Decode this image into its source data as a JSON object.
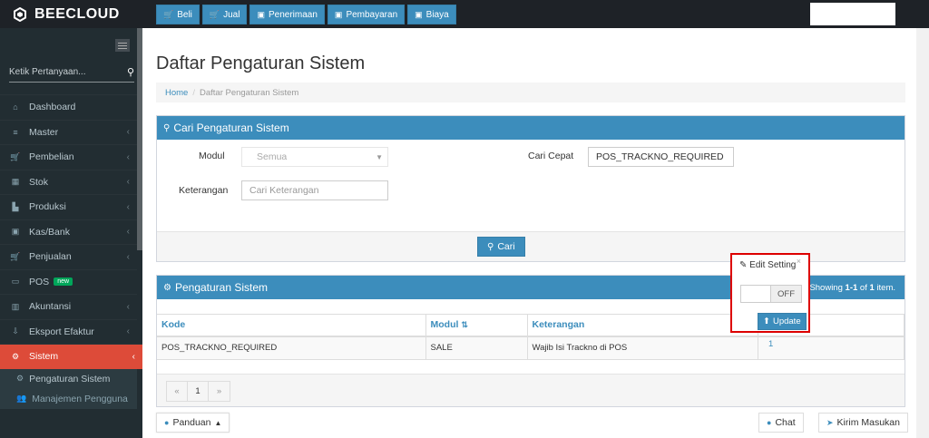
{
  "brand": {
    "name": "BEECLOUD"
  },
  "topnav": [
    {
      "icon": "cart-icon",
      "glyph": "🛒",
      "label": "Beli"
    },
    {
      "icon": "cart-icon",
      "glyph": "🛒",
      "label": "Jual"
    },
    {
      "icon": "money-icon",
      "glyph": "▣",
      "label": "Penerimaan"
    },
    {
      "icon": "money-icon",
      "glyph": "▣",
      "label": "Pembayaran"
    },
    {
      "icon": "money-icon",
      "glyph": "▣",
      "label": "Biaya"
    }
  ],
  "sidebar": {
    "search_placeholder": "Ketik Pertanyaan...",
    "items": [
      {
        "label": "Dashboard",
        "icon": "dashboard-icon"
      },
      {
        "label": "Master",
        "icon": "list-icon"
      },
      {
        "label": "Pembelian",
        "icon": "cart-icon"
      },
      {
        "label": "Stok",
        "icon": "stock-icon"
      },
      {
        "label": "Produksi",
        "icon": "factory-icon"
      },
      {
        "label": "Kas/Bank",
        "icon": "money-icon"
      },
      {
        "label": "Penjualan",
        "icon": "cart-icon"
      },
      {
        "label": "POS",
        "icon": "monitor-icon",
        "badge": "new"
      },
      {
        "label": "Akuntansi",
        "icon": "chart-icon"
      },
      {
        "label": "Eksport Efaktur",
        "icon": "export-icon"
      },
      {
        "label": "Sistem",
        "icon": "gears-icon"
      }
    ],
    "subitems": [
      {
        "label": "Pengaturan Sistem",
        "icon": "gear-icon"
      },
      {
        "label": "Manajemen Pengguna",
        "icon": "users-icon"
      }
    ]
  },
  "page": {
    "title": "Daftar Pengaturan Sistem",
    "breadcrumb": {
      "home": "Home",
      "current": "Daftar Pengaturan Sistem"
    }
  },
  "search_panel": {
    "title": "Cari Pengaturan Sistem",
    "modul_label": "Modul",
    "modul_value": "Semua",
    "keterangan_label": "Keterangan",
    "keterangan_placeholder": "Cari Keterangan",
    "cari_cepat_label": "Cari Cepat",
    "cari_cepat_value": "POS_TRACKNO_REQUIRED",
    "button": "Cari"
  },
  "list_panel": {
    "title": "Pengaturan Sistem",
    "showing_prefix": "Showing ",
    "showing_range": "1-1",
    "showing_mid": " of ",
    "showing_total": "1",
    "showing_suffix": " item.",
    "columns": {
      "kode": "Kode",
      "modul": "Modul",
      "keterangan": "Keterangan"
    },
    "rows": [
      {
        "kode": "POS_TRACKNO_REQUIRED",
        "modul": "SALE",
        "keterangan": "Wajib Isi Trackno di POS",
        "value": "1"
      }
    ],
    "pager": {
      "prev": "«",
      "page": "1",
      "next": "»"
    }
  },
  "popover": {
    "title": "Edit Setting",
    "close": "×",
    "toggle_label": "OFF",
    "button": "Update"
  },
  "footer": {
    "panduan": "Panduan",
    "chat": "Chat",
    "kirim": "Kirim Masukan"
  }
}
